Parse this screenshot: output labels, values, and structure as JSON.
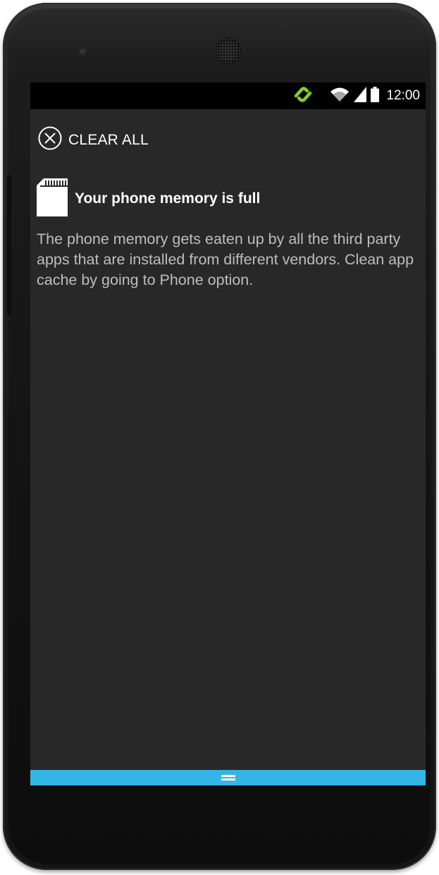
{
  "status_bar": {
    "time": "12:00",
    "icons": [
      "sync-icon",
      "wifi-icon",
      "signal-icon",
      "battery-icon"
    ],
    "sync_color": "#7ed321"
  },
  "actions": {
    "clear_all_label": "CLEAR ALL",
    "clear_all_icon": "close-circle-icon"
  },
  "notification": {
    "icon": "sd-card-icon",
    "title": "Your phone memory is full",
    "body": "The phone memory gets eaten up by all the third party apps that are installed from different vendors. Clean app cache by going to Phone option."
  },
  "bottom_bar": {
    "color": "#33b5e5",
    "icon": "drag-handle-icon"
  }
}
